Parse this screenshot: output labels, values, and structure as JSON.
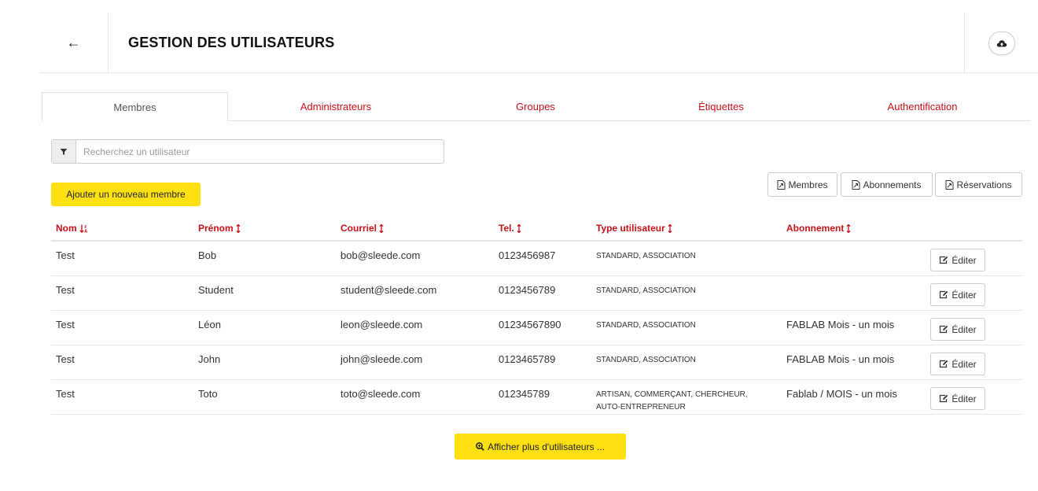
{
  "header": {
    "back_icon": "arrow-left-icon",
    "back_label": "←",
    "title": "GESTION DES UTILISATEURS",
    "cloud_icon": "cloud-upload-icon"
  },
  "tabs": [
    {
      "label": "Membres",
      "active": true
    },
    {
      "label": "Administrateurs",
      "active": false
    },
    {
      "label": "Groupes",
      "active": false
    },
    {
      "label": "Étiquettes",
      "active": false
    },
    {
      "label": "Authentification",
      "active": false
    }
  ],
  "search": {
    "icon": "filter-icon",
    "placeholder": "Recherchez un utilisateur",
    "value": ""
  },
  "add_member_label": "Ajouter un nouveau membre",
  "exports": [
    {
      "label": "Membres",
      "icon": "file-export-icon"
    },
    {
      "label": "Abonnements",
      "icon": "file-export-icon"
    },
    {
      "label": "Réservations",
      "icon": "file-export-icon"
    }
  ],
  "table": {
    "headers": [
      "Nom",
      "Prénom",
      "Courriel",
      "Tel.",
      "Type utilisateur",
      "Abonnement"
    ],
    "edit_label": "Éditer",
    "rows": [
      {
        "nom": "Test",
        "prenom": "Bob",
        "courriel": "bob@sleede.com",
        "tel": "0123456987",
        "type": "STANDARD, ASSOCIATION",
        "abonnement": ""
      },
      {
        "nom": "Test",
        "prenom": "Student",
        "courriel": "student@sleede.com",
        "tel": "0123456789",
        "type": "STANDARD, ASSOCIATION",
        "abonnement": ""
      },
      {
        "nom": "Test",
        "prenom": "Léon",
        "courriel": "leon@sleede.com",
        "tel": "01234567890",
        "type": "STANDARD, ASSOCIATION",
        "abonnement": "FABLAB Mois - un mois"
      },
      {
        "nom": "Test",
        "prenom": "John",
        "courriel": "john@sleede.com",
        "tel": "0123465789",
        "type": "STANDARD, ASSOCIATION",
        "abonnement": "FABLAB Mois - un mois"
      },
      {
        "nom": "Test",
        "prenom": "Toto",
        "courriel": "toto@sleede.com",
        "tel": "012345789",
        "type": "ARTISAN, COMMERÇANT, CHERCHEUR,",
        "type_line2": "AUTO-ENTREPRENEUR",
        "abonnement": "Fablab / MOIS - un mois"
      }
    ]
  },
  "more_label": "Afficher plus d'utilisateurs ...",
  "colors": {
    "accent": "#cb1117",
    "yellow": "#fde012"
  }
}
